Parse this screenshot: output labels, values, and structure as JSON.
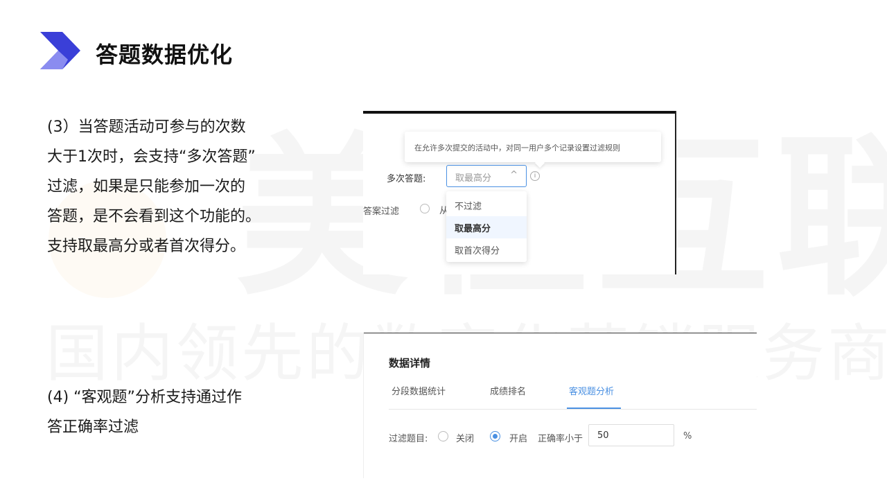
{
  "title": "答题数据优化",
  "watermark": {
    "brand": "美橙互联",
    "slogan": "国内领先的数字化营销服务商"
  },
  "paragraphs": {
    "p1": [
      "(3）当答题活动可参与的次数",
      "大于1次时，会支持“多次答题”",
      "过滤，如果是只能参加一次的",
      "答题，是不会看到这个功能的。",
      "支持取最高分或者首次得分。"
    ],
    "p2": [
      "(4) “客观题”分析支持通过作",
      "答正确率过滤"
    ]
  },
  "shot1": {
    "tooltip": "在允许多次提交的活动中，对同一用户多个记录设置过滤规则",
    "multi_label": "多次答题:",
    "select_value": "取最高分",
    "filter_label": "答案过滤",
    "radio_cut_text": "从",
    "options": [
      "不过滤",
      "取最高分",
      "取首次得分"
    ]
  },
  "shot2": {
    "title": "数据详情",
    "tabs": [
      "分段数据统计",
      "成绩排名",
      "客观题分析"
    ],
    "filter_label": "过滤题目:",
    "off_label": "关闭",
    "on_label": "开启",
    "rate_label": "正确率小于",
    "rate_value": "50",
    "unit": "%"
  },
  "colors": {
    "accent": "#4a90e2",
    "logo_dark": "#3a3fd8",
    "logo_light": "#8a8cf0"
  }
}
